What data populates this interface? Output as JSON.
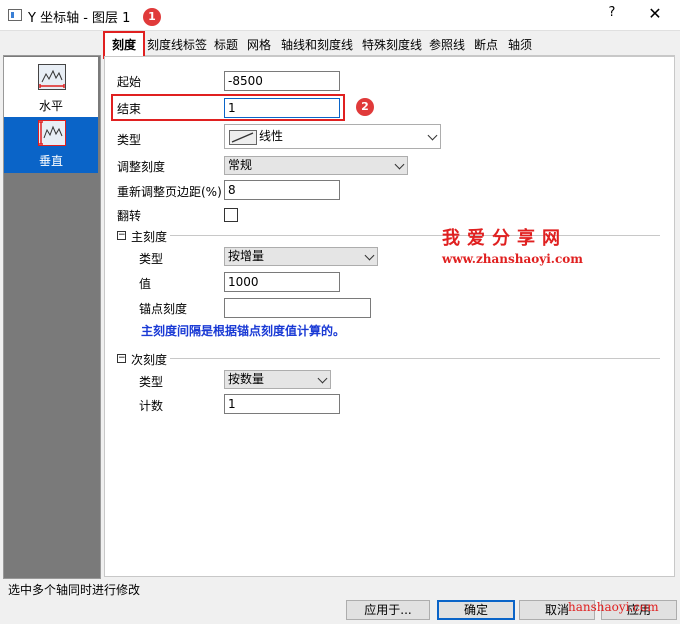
{
  "window": {
    "title": "Y 坐标轴 - 图层 1",
    "help": "?",
    "close": "✕"
  },
  "tabs": [
    {
      "label": "刻度"
    },
    {
      "label": "刻度线标签"
    },
    {
      "label": "标题"
    },
    {
      "label": "网格"
    },
    {
      "label": "轴线和刻度线"
    },
    {
      "label": "特殊刻度线"
    },
    {
      "label": "参照线"
    },
    {
      "label": "断点"
    },
    {
      "label": "轴须"
    }
  ],
  "sidebar": {
    "items": [
      {
        "label": "水平"
      },
      {
        "label": "垂直",
        "selected": true
      }
    ]
  },
  "form": {
    "start": {
      "label": "起始",
      "value": "-8500"
    },
    "end": {
      "label": "结束",
      "value": "1"
    },
    "type": {
      "label": "类型",
      "value": "线性"
    },
    "rescale": {
      "label": "调整刻度",
      "value": "常规"
    },
    "rescale_margin": {
      "label": "重新调整页边距(%)",
      "value": "8"
    },
    "flip": {
      "label": "翻转",
      "checked": false
    }
  },
  "major": {
    "header": "主刻度",
    "type": {
      "label": "类型",
      "value": "按增量"
    },
    "value": {
      "label": "值",
      "value": "1000"
    },
    "anchor": {
      "label": "锚点刻度",
      "value": ""
    },
    "note": "主刻度间隔是根据锚点刻度值计算的。"
  },
  "minor": {
    "header": "次刻度",
    "type": {
      "label": "类型",
      "value": "按数量"
    },
    "count": {
      "label": "计数",
      "value": "1"
    }
  },
  "annotations": {
    "badge1": "1",
    "badge2": "2"
  },
  "watermark": {
    "title": "我爱分享网",
    "url": "www.zhanshaoyi.com",
    "url_partial": "hanshaoyi.com"
  },
  "status": "选中多个轴同时进行修改",
  "buttons": {
    "apply_to": "应用于...",
    "ok": "确定",
    "cancel": "取消",
    "apply": "应用"
  },
  "colors": {
    "accent": "#0a64c8",
    "highlight": "#e02020",
    "note": "#1a3ad5"
  }
}
